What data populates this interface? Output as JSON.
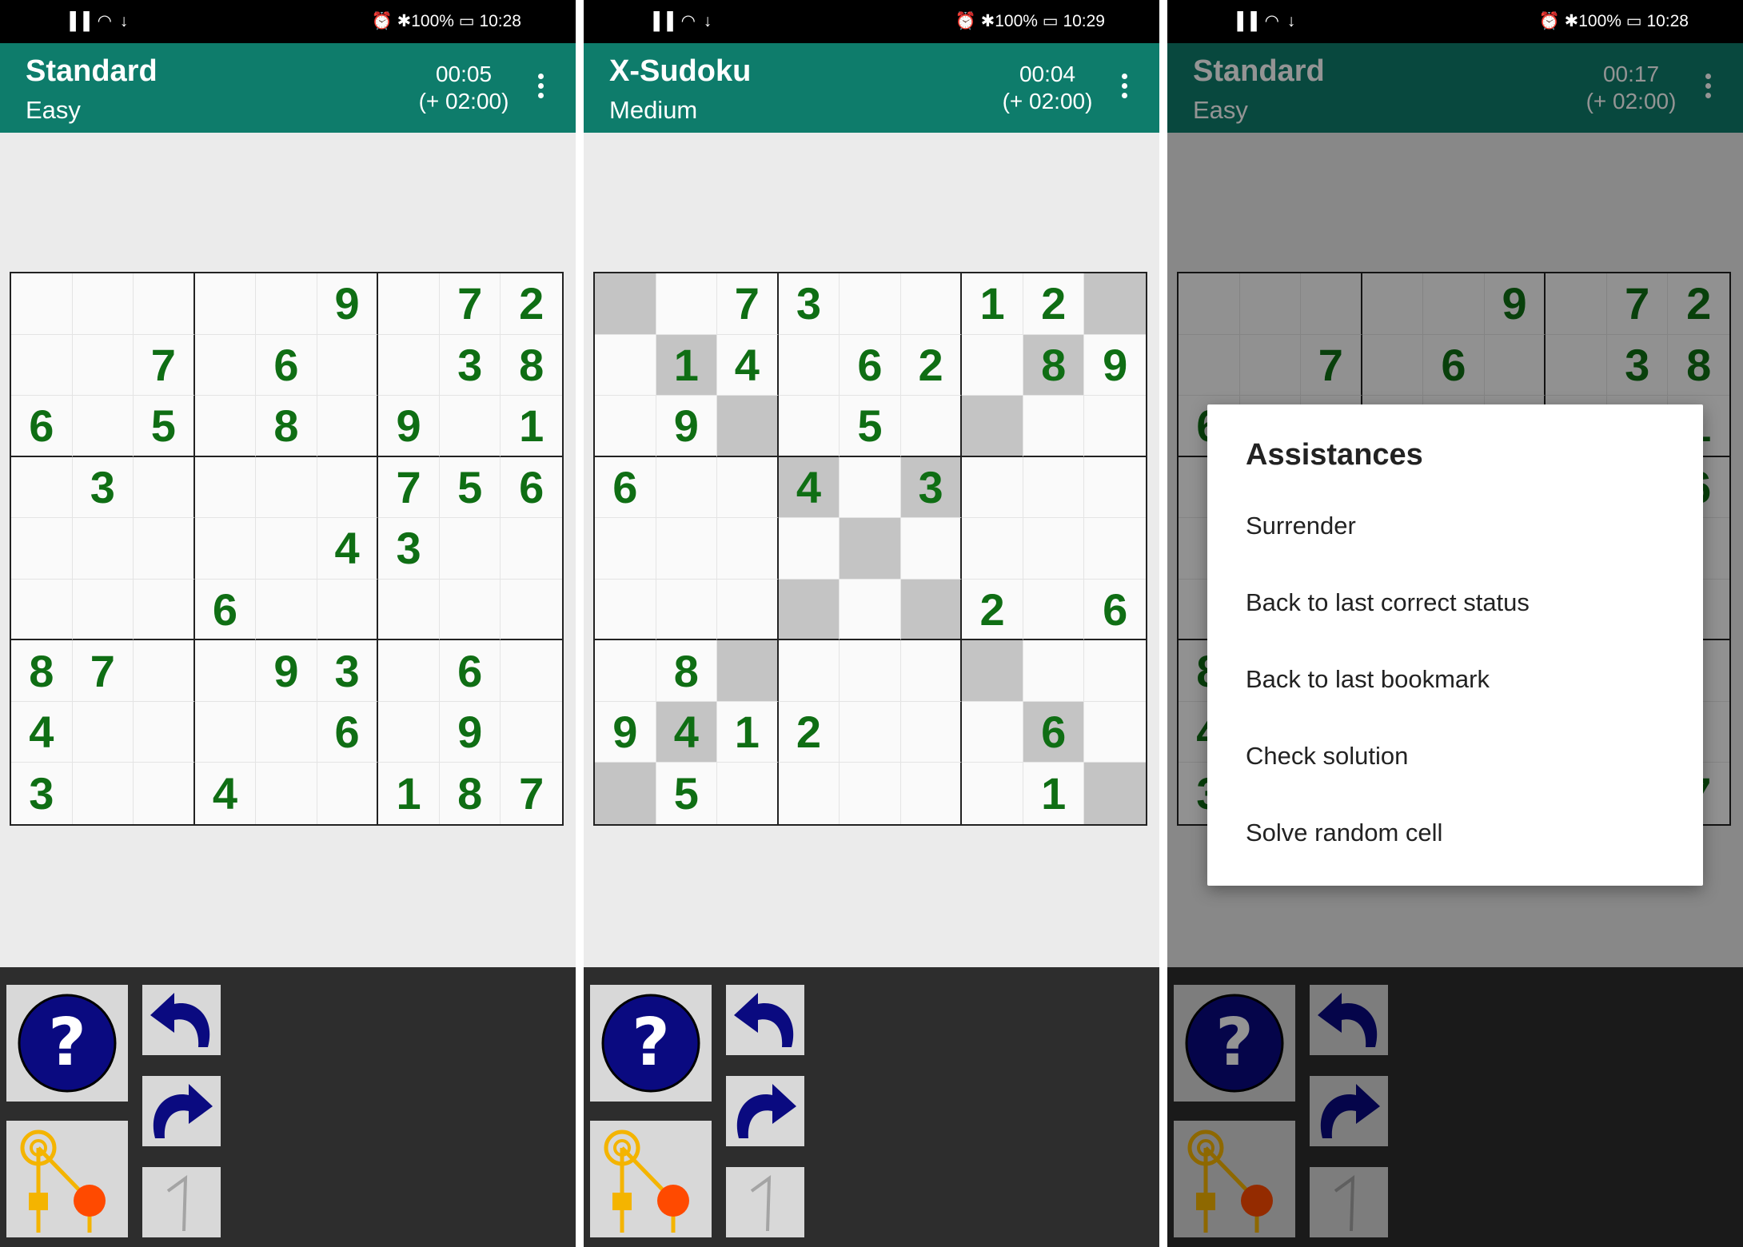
{
  "panels": [
    {
      "status": {
        "signal": "▐▐ ◠ ↓",
        "right": "⏰ ✱100% ▭ 10:28"
      },
      "title": "Standard",
      "difficulty": "Easy",
      "time": "00:05",
      "penalty": "(+ 02:00)",
      "diagonals": false,
      "grid": [
        "00000907 2",
        "",
        "",
        "",
        "",
        "",
        "",
        "",
        ""
      ],
      "rows": [
        [
          "",
          "",
          "",
          "",
          "",
          "9",
          "",
          "7",
          "2"
        ],
        [
          "",
          "",
          "7",
          "",
          "6",
          "",
          "",
          "3",
          "8"
        ],
        [
          "6",
          "",
          "5",
          "",
          "8",
          "",
          "9",
          "",
          "1"
        ],
        [
          "",
          "3",
          "",
          "",
          "",
          "",
          "7",
          "5",
          "6"
        ],
        [
          "",
          "",
          "",
          "",
          "",
          "4",
          "3",
          "",
          ""
        ],
        [
          "",
          "",
          "",
          "6",
          "",
          "",
          "",
          "",
          ""
        ],
        [
          "8",
          "7",
          "",
          "",
          "9",
          "3",
          "",
          "6",
          ""
        ],
        [
          "4",
          "",
          "",
          "",
          "",
          "6",
          "",
          "9",
          ""
        ],
        [
          "3",
          "",
          "",
          "4",
          "",
          "",
          "1",
          "8",
          "7"
        ]
      ]
    },
    {
      "status": {
        "signal": "▐▐ ◠ ↓",
        "right": "⏰ ✱100% ▭ 10:29"
      },
      "title": "X-Sudoku",
      "difficulty": "Medium",
      "time": "00:04",
      "penalty": "(+ 02:00)",
      "diagonals": true,
      "rows": [
        [
          "",
          "",
          "7",
          "3",
          "",
          "",
          "1",
          "2",
          ""
        ],
        [
          "",
          "1",
          "4",
          "",
          "6",
          "2",
          "",
          "8",
          "9"
        ],
        [
          "",
          "9",
          "",
          "",
          "5",
          "",
          "",
          "",
          ""
        ],
        [
          "6",
          "",
          "",
          "4",
          "",
          "3",
          "",
          "",
          ""
        ],
        [
          "",
          "",
          "",
          "",
          "",
          "",
          "",
          "",
          ""
        ],
        [
          "",
          "",
          "",
          "",
          "",
          "",
          "2",
          "",
          "6"
        ],
        [
          "",
          "8",
          "",
          "",
          "",
          "",
          "",
          "",
          ""
        ],
        [
          "9",
          "4",
          "1",
          "2",
          "",
          "",
          "",
          "6",
          ""
        ],
        [
          "",
          "5",
          "",
          "",
          "",
          "",
          "",
          "1",
          ""
        ]
      ]
    },
    {
      "status": {
        "signal": "▐▐ ◠ ↓",
        "right": "⏰ ✱100% ▭ 10:28"
      },
      "title": "Standard",
      "difficulty": "Easy",
      "time": "00:17",
      "penalty": "(+ 02:00)",
      "diagonals": false,
      "rows": [
        [
          "",
          "",
          "",
          "",
          "",
          "9",
          "",
          "7",
          "2"
        ],
        [
          "",
          "",
          "7",
          "",
          "6",
          "",
          "",
          "3",
          "8"
        ],
        [
          "6",
          "",
          "5",
          "",
          "8",
          "",
          "9",
          "",
          "1"
        ],
        [
          "",
          "3",
          "",
          "",
          "",
          "",
          "7",
          "5",
          "6"
        ],
        [
          "",
          "",
          "",
          "",
          "",
          "4",
          "3",
          "",
          ""
        ],
        [
          "",
          "",
          "",
          "6",
          "",
          "",
          "",
          "",
          ""
        ],
        [
          "8",
          "7",
          "",
          "",
          "9",
          "3",
          "",
          "6",
          ""
        ],
        [
          "4",
          "",
          "",
          "",
          "",
          "6",
          "",
          "9",
          ""
        ],
        [
          "3",
          "",
          "",
          "4",
          "",
          "",
          "1",
          "8",
          "7"
        ]
      ]
    }
  ],
  "dialog": {
    "title": "Assistances",
    "items": [
      "Surrender",
      "Back to last correct status",
      "Back to last bookmark",
      "Check solution",
      "Solve random cell"
    ]
  },
  "toolbar": {
    "help_icon": "help-question-icon",
    "undo_icon": "undo-arrow-icon",
    "redo_icon": "redo-arrow-icon",
    "tree_icon": "solution-tree-icon",
    "digit_icon": "digit-one-icon"
  },
  "colors": {
    "appbar": "#0e7c6b",
    "digits": "#0f6e14",
    "diagonal_cell": "#c4c4c4",
    "toolbar_bg": "#2d2d2d",
    "help_circle": "#0a0a80"
  }
}
